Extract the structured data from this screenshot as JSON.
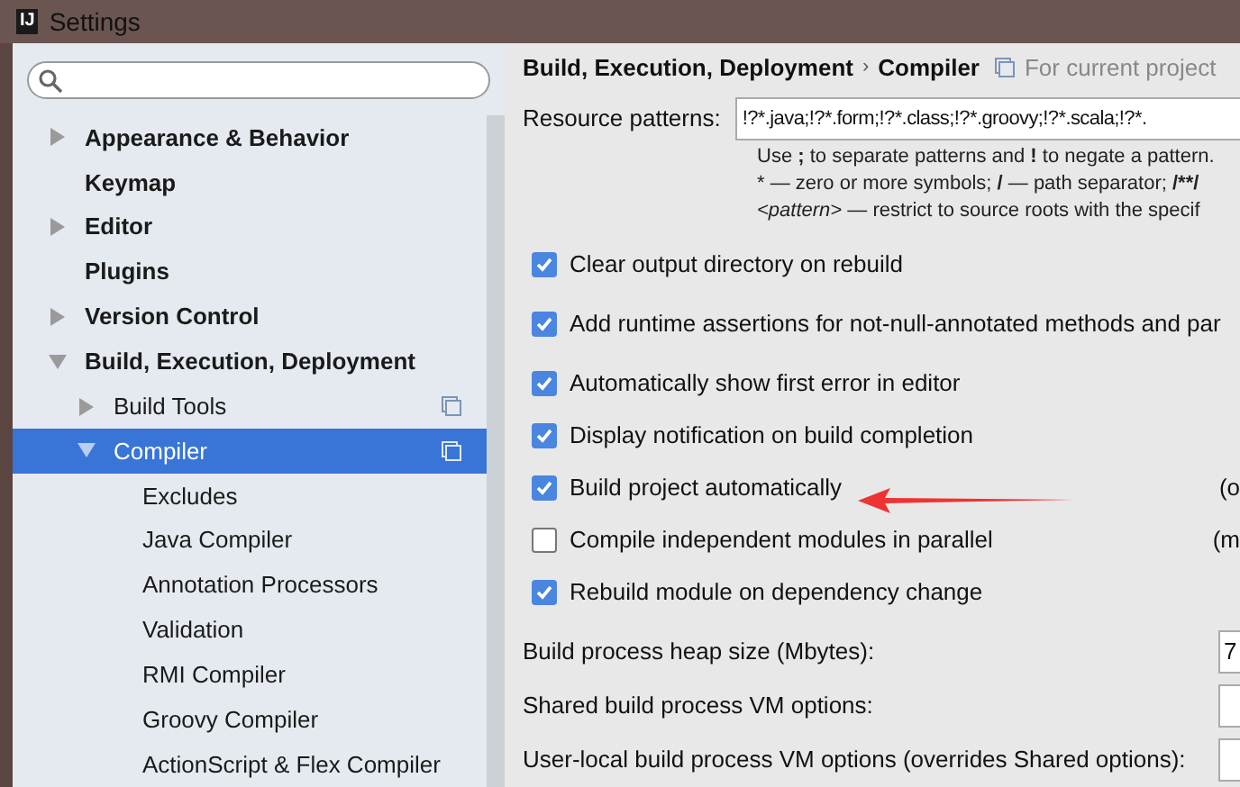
{
  "window": {
    "logo": "IJ",
    "title": "Settings"
  },
  "tree": [
    {
      "label": "Appearance & Behavior",
      "expanded": false,
      "selected": false
    },
    {
      "label": "Keymap",
      "selected": false
    },
    {
      "label": "Editor",
      "expanded": false,
      "selected": false
    },
    {
      "label": "Plugins",
      "selected": false
    },
    {
      "label": "Version Control",
      "expanded": false,
      "selected": false
    },
    {
      "label": "Build, Execution, Deployment",
      "expanded": true,
      "selected": false,
      "children": [
        {
          "label": "Build Tools",
          "kind": "project",
          "expanded": false,
          "selected": false
        },
        {
          "label": "Compiler",
          "kind": "project",
          "expanded": true,
          "selected": true,
          "children": [
            {
              "label": "Excludes",
              "selected": false
            },
            {
              "label": "Java Compiler",
              "selected": false
            },
            {
              "label": "Annotation Processors",
              "selected": false
            },
            {
              "label": "Validation",
              "selected": false
            },
            {
              "label": "RMI Compiler",
              "selected": false
            },
            {
              "label": "Groovy Compiler",
              "selected": false
            },
            {
              "label": "ActionScript & Flex Compiler",
              "selected": false
            }
          ]
        }
      ]
    }
  ],
  "breadcrumb": {
    "parent": "Build, Execution, Deployment",
    "separator": "›",
    "current": "Compiler",
    "scope": "For current project"
  },
  "resource_patterns": {
    "label": "Resource patterns:",
    "value": "!?*.java;!?*.form;!?*.class;!?*.groovy;!?*.scala;!?*.",
    "hint": [
      {
        "rich": "Use **;** to separate patterns and **!** to negate a pattern."
      },
      {
        "parts": [
          "* — zero or more symbols; ",
          "/",
          " — path separator; ",
          "/**/"
        ]
      },
      {
        "rich": "*<pattern>* — restrict to source roots with the specif"
      }
    ]
  },
  "options": [
    {
      "label": "Clear output directory on rebuild",
      "checked": true
    },
    {
      "label": "Add runtime assertions for not-null-annotated methods and par",
      "checked": true
    },
    {
      "label": "Automatically show first error in editor",
      "checked": true
    },
    {
      "label": "Display notification on build completion",
      "checked": true
    },
    {
      "label": "Build project automatically",
      "checked": true,
      "column_2": "(o"
    },
    {
      "label": "Compile independent modules in parallel",
      "checked": false,
      "column_2": "(m"
    },
    {
      "label": "Rebuild module on dependency change",
      "checked": true
    }
  ],
  "vm_fields": [
    {
      "label": "Build process heap size (Mbytes):",
      "value": "7"
    },
    {
      "label": "Shared build process VM options:"
    },
    {
      "label": "User-local build process VM options (overrides Shared options):"
    }
  ]
}
